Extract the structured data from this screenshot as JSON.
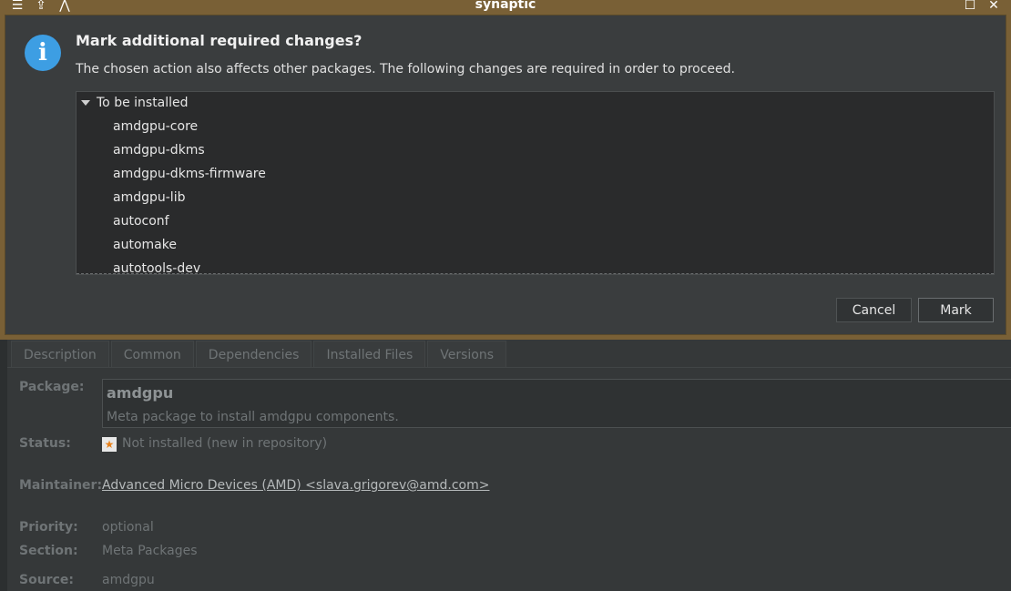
{
  "window": {
    "title": "synaptic"
  },
  "dialog": {
    "heading": "Mark additional required changes?",
    "message": "The chosen action also affects other packages. The following changes are required in order to proceed.",
    "tree": {
      "root_label": "To be installed",
      "items": [
        "amdgpu-core",
        "amdgpu-dkms",
        "amdgpu-dkms-firmware",
        "amdgpu-lib",
        "autoconf",
        "automake",
        "autotools-dev"
      ]
    },
    "cancel_label": "Cancel",
    "mark_label": "Mark"
  },
  "details": {
    "tabs": [
      "Description",
      "Common",
      "Dependencies",
      "Installed Files",
      "Versions"
    ],
    "package_label": "Package:",
    "package_name": "amdgpu",
    "package_summary": "Meta package to install amdgpu components.",
    "status_label": "Status:",
    "status_value": "Not installed (new in repository)",
    "maintainer_label": "Maintainer:",
    "maintainer_value": "Advanced Micro Devices (AMD) <slava.grigorev@amd.com>",
    "priority_label": "Priority:",
    "priority_value": "optional",
    "section_label": "Section:",
    "section_value": "Meta Packages",
    "source_label": "Source:",
    "source_value": "amdgpu"
  },
  "icons": {
    "titlebar_left": [
      "menu-icon",
      "keep-above-icon",
      "shade-icon"
    ],
    "titlebar_right": [
      "maximize-icon",
      "close-icon"
    ],
    "dialog": "info-icon",
    "status": "new-package-star-icon"
  },
  "colors": {
    "accent_frame": "#796036",
    "info_blue": "#3d9ee3"
  }
}
